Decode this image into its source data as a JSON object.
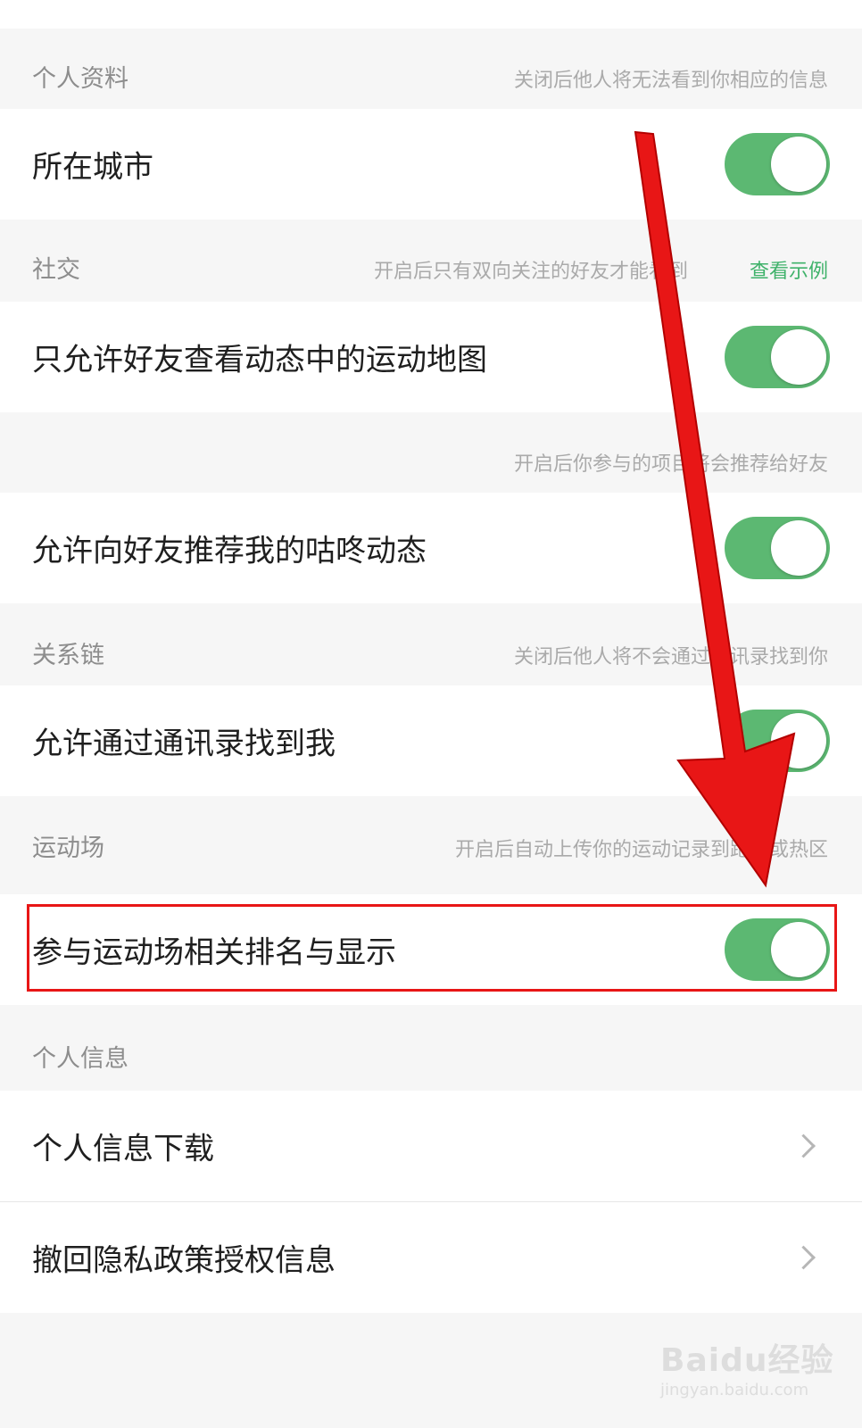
{
  "sections": {
    "profile": {
      "title": "个人资料",
      "note": "关闭后他人将无法看到你相应的信息"
    },
    "social": {
      "title": "社交",
      "note": "开启后只有双向关注的好友才能看到",
      "link": "查看示例"
    },
    "recommend": {
      "note": "开启后你参与的项目将会推荐给好友"
    },
    "relations": {
      "title": "关系链",
      "note": "关闭后他人将不会通过通讯录找到你"
    },
    "playground": {
      "title": "运动场",
      "note": "开启后自动上传你的运动记录到跑步或热区"
    },
    "personal_info": {
      "title": "个人信息"
    }
  },
  "rows": {
    "city": {
      "label": "所在城市",
      "toggle_on": true
    },
    "friends_map": {
      "label": "只允许好友查看动态中的运动地图",
      "toggle_on": true
    },
    "recommend_feed": {
      "label": "允许向好友推荐我的咕咚动态",
      "toggle_on": true
    },
    "contacts": {
      "label": "允许通过通讯录找到我",
      "toggle_on": true
    },
    "ranking": {
      "label": "参与运动场相关排名与显示",
      "toggle_on": true
    },
    "download": {
      "label": "个人信息下载"
    },
    "revoke": {
      "label": "撤回隐私政策授权信息"
    }
  },
  "watermark": {
    "text": "Baidu经验",
    "sub": "jingyan.baidu.com"
  },
  "colors": {
    "toggle_on": "#5cb872",
    "link": "#3fb26a",
    "annotation": "#e81616"
  }
}
